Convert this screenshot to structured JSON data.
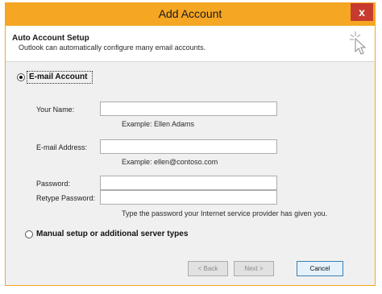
{
  "window": {
    "title": "Add Account",
    "close_label": "x"
  },
  "header": {
    "title": "Auto Account Setup",
    "subtitle": "Outlook can automatically configure many email accounts."
  },
  "options": {
    "email_account": {
      "label": "E-mail Account",
      "selected": true
    },
    "manual_setup": {
      "label": "Manual setup or additional server types",
      "selected": false
    }
  },
  "form": {
    "your_name": {
      "label": "Your Name:",
      "value": "",
      "example": "Example: Ellen Adams"
    },
    "email_address": {
      "label": "E-mail Address:",
      "value": "",
      "example": "Example: ellen@contoso.com"
    },
    "password": {
      "label": "Password:",
      "value": ""
    },
    "retype_password": {
      "label": "Retype Password:",
      "value": ""
    },
    "password_hint": "Type the password your Internet service provider has given you."
  },
  "buttons": {
    "back": "< Back",
    "next": "Next >",
    "cancel": "Cancel"
  },
  "colors": {
    "titlebar": "#f5a623",
    "close": "#c73b2f",
    "dialog_bg": "#f0f0f0"
  },
  "icons": {
    "wizard": "wizard-sparkle-cursor-icon"
  }
}
